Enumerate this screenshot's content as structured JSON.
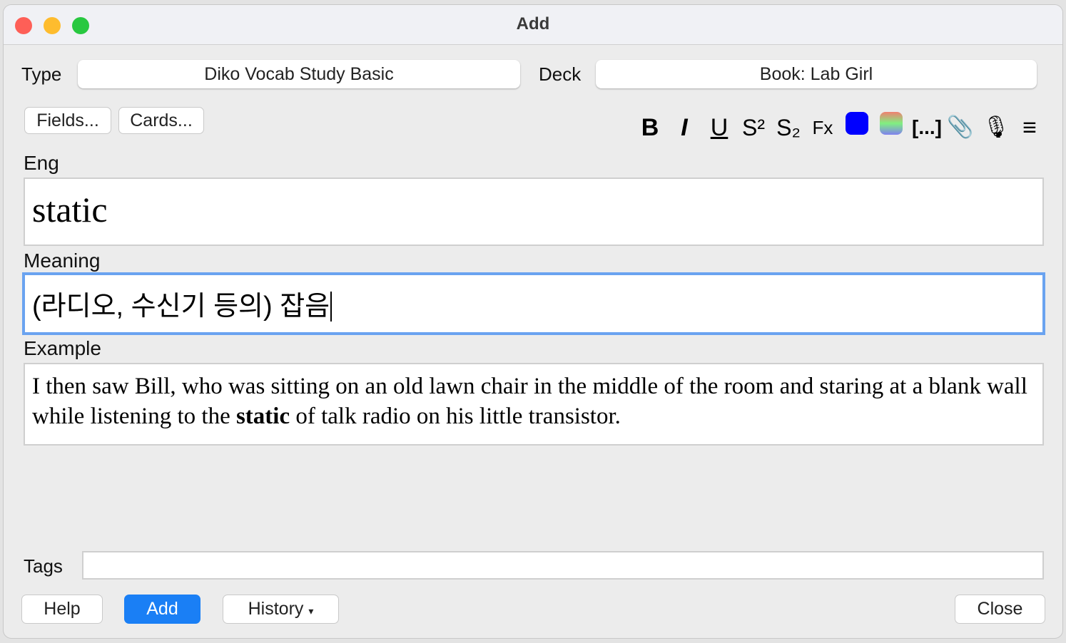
{
  "window": {
    "title": "Add"
  },
  "type": {
    "label": "Type",
    "value": "Diko Vocab Study Basic"
  },
  "deck": {
    "label": "Deck",
    "value": "Book: Lab Girl"
  },
  "buttons": {
    "fields": "Fields...",
    "cards": "Cards...",
    "help": "Help",
    "add": "Add",
    "history": "History",
    "history_arrow": "▾",
    "close": "Close"
  },
  "toolbar": {
    "bold": "B",
    "italic": "I",
    "underline": "U",
    "superscript": "S²",
    "subscript": "S₂",
    "clear_format": "Fx",
    "cloze": "[...]",
    "text_color": "#0000ff"
  },
  "fields": [
    {
      "label": "Eng",
      "value": "static"
    },
    {
      "label": "Meaning",
      "value": "(라디오, 수신기 등의) 잡음"
    },
    {
      "label": "Example",
      "before": "I then saw Bill, who was sitting on an old lawn chair in the middle of the room and staring at a blank wall while listening to the ",
      "bold": "static",
      "after": " of talk radio on his little transistor."
    }
  ],
  "tags": {
    "label": "Tags",
    "value": ""
  },
  "colors": {
    "accent": "#1a7ff5",
    "focus": "#6aa3f0"
  }
}
